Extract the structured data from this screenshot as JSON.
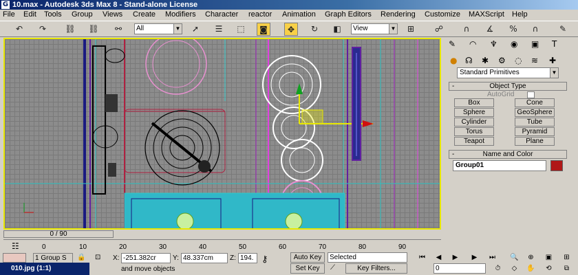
{
  "window": {
    "title": "10.max - Autodesk 3ds Max 8 - Stand-alone License"
  },
  "menu": [
    "File",
    "Edit",
    "Tools",
    "Group",
    "Views",
    "Create",
    "Modifiers",
    "Character",
    "reactor",
    "Animation",
    "Graph Editors",
    "Rendering",
    "Customize",
    "MAXScript",
    "Help"
  ],
  "toolbar": {
    "selection_filter": "All",
    "reference_coord": "View"
  },
  "command_panel": {
    "category": "Standard Primitives",
    "object_type_header": "Object Type",
    "autogrid_label": "AutoGrid",
    "buttons": [
      "Box",
      "Cone",
      "Sphere",
      "GeoSphere",
      "Cylinder",
      "Tube",
      "Torus",
      "Pyramid",
      "Teapot",
      "Plane"
    ],
    "name_color_header": "Name and Color",
    "object_name": "Group01",
    "object_color": "#b01818",
    "rollout_sign": "-"
  },
  "time_slider": {
    "label": "0 / 90",
    "current": 0,
    "total": 90
  },
  "track_ticks": [
    "0",
    "10",
    "20",
    "30",
    "40",
    "50",
    "60",
    "70",
    "80",
    "90"
  ],
  "status": {
    "selection": "1 Group S",
    "x_label": "X:",
    "x_value": "-251.382cr",
    "y_label": "Y:",
    "y_value": "48.337cm",
    "z_label": "Z:",
    "z_value": "194.",
    "prompt": "and move objects",
    "autokey": "Auto Key",
    "setkey": "Set Key",
    "key_mode": "Selected",
    "key_filters": "Key Filters...",
    "frame": "0"
  },
  "taskbar": {
    "label": "010.jpg (1:1)"
  },
  "colors": {
    "viewport_border": "#e8e800",
    "selection": "#ffffff",
    "pink": "#e890d0",
    "purple": "#6020a0",
    "cyan": "#30c8c8"
  }
}
